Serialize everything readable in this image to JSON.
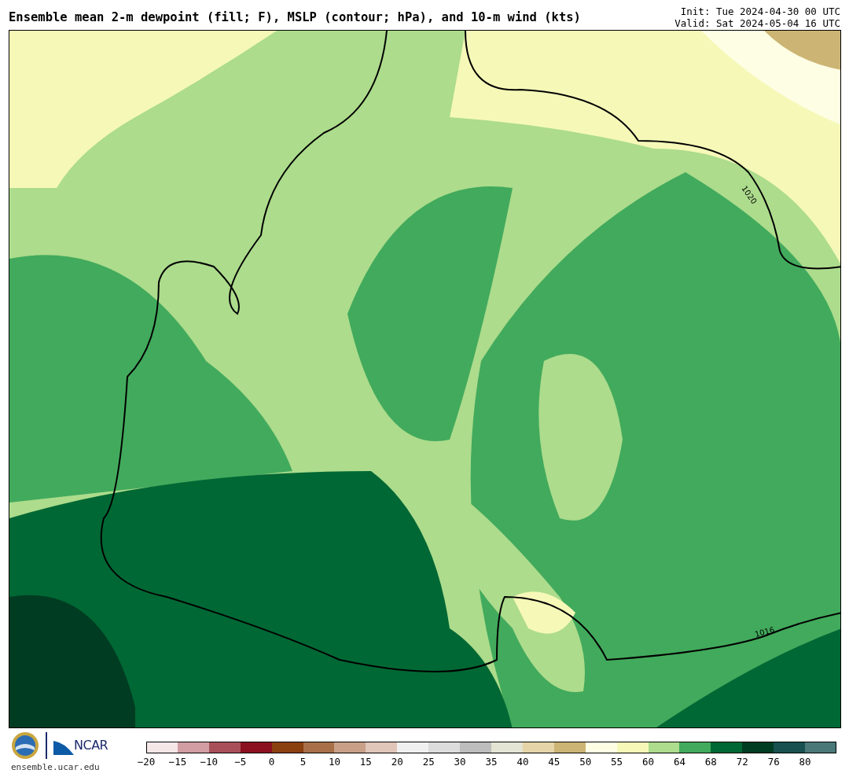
{
  "header": {
    "title": "Ensemble mean 2-m dewpoint (fill; F), MSLP (contour; hPa), and 10-m wind (kts)",
    "init": "Init: Tue 2024-04-30 00 UTC",
    "valid": "Valid: Sat 2024-05-04 16 UTC"
  },
  "map": {
    "contour_labels": [
      "1020",
      "1016"
    ]
  },
  "footer": {
    "logo_text": "NCAR",
    "site": "ensemble.ucar.edu"
  },
  "colorbar": {
    "bins": [
      {
        "color": "#f5e6e8"
      },
      {
        "color": "#d09ea3"
      },
      {
        "color": "#a8505a"
      },
      {
        "color": "#8b1020"
      },
      {
        "color": "#8b4010"
      },
      {
        "color": "#a87048"
      },
      {
        "color": "#c8a088"
      },
      {
        "color": "#e0c6b8"
      },
      {
        "color": "#f0f0f0"
      },
      {
        "color": "#dcdcdc"
      },
      {
        "color": "#bdbdbd"
      },
      {
        "color": "#e4e4d4"
      },
      {
        "color": "#e4d4a8"
      },
      {
        "color": "#ccb474"
      },
      {
        "color": "#fefee4"
      },
      {
        "color": "#f6f8b8"
      },
      {
        "color": "#acdc8c"
      },
      {
        "color": "#42aa5c"
      },
      {
        "color": "#006834"
      },
      {
        "color": "#003c22"
      },
      {
        "color": "#17504f"
      },
      {
        "color": "#4a7878"
      }
    ],
    "ticks": [
      "−20",
      "−15",
      "−10",
      "−5",
      "0",
      "5",
      "10",
      "15",
      "20",
      "25",
      "30",
      "35",
      "40",
      "45",
      "50",
      "55",
      "60",
      "64",
      "68",
      "72",
      "76",
      "80"
    ]
  }
}
